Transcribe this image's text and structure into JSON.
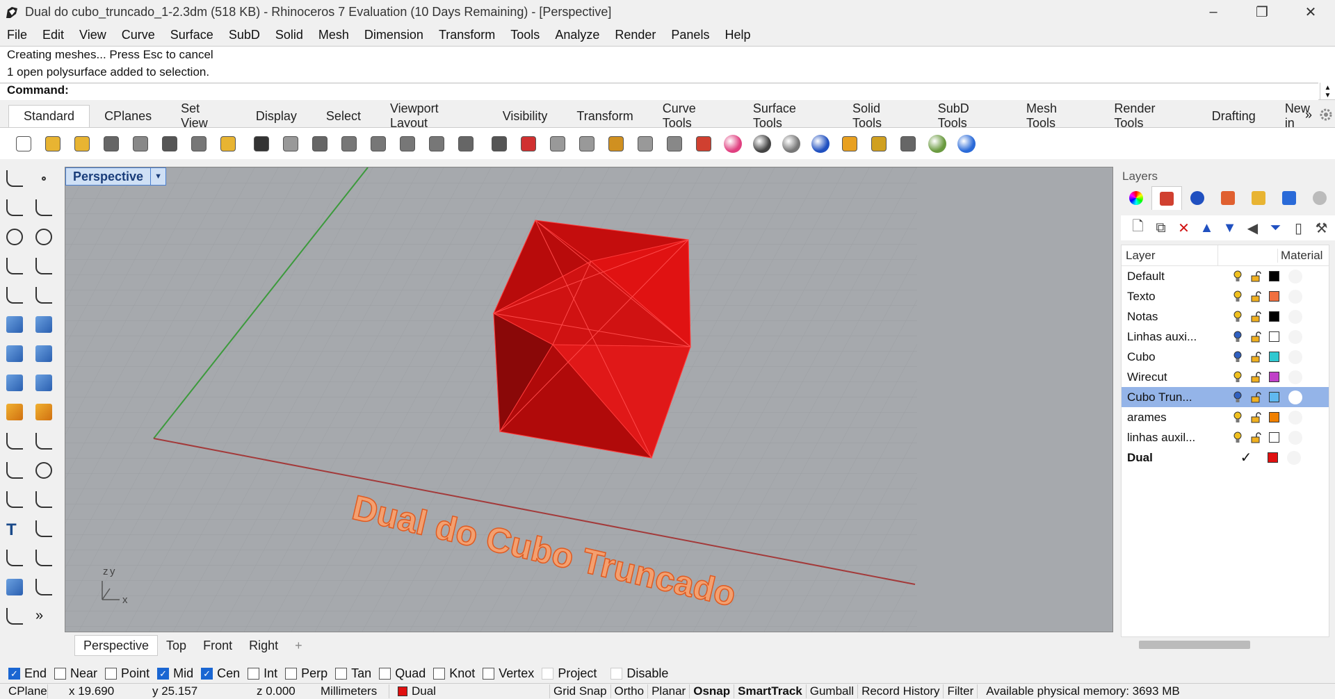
{
  "window": {
    "title": "Dual do cubo_truncado_1-2.3dm (518 KB) - Rhinoceros 7 Evaluation (10 Days Remaining) - [Perspective]",
    "controls": [
      "–",
      "❐",
      "✕"
    ]
  },
  "menu": [
    "File",
    "Edit",
    "View",
    "Curve",
    "Surface",
    "SubD",
    "Solid",
    "Mesh",
    "Dimension",
    "Transform",
    "Tools",
    "Analyze",
    "Render",
    "Panels",
    "Help"
  ],
  "command": {
    "history": [
      "Creating meshes... Press Esc to cancel",
      "1 open polysurface added to selection."
    ],
    "prompt": "Command:"
  },
  "toolbar_tabs": [
    "Standard",
    "CPlanes",
    "Set View",
    "Display",
    "Select",
    "Viewport Layout",
    "Visibility",
    "Transform",
    "Curve Tools",
    "Surface Tools",
    "Solid Tools",
    "SubD Tools",
    "Mesh Tools",
    "Render Tools",
    "Drafting",
    "New in"
  ],
  "toolbar_overflow": "»",
  "toolbar_icons": [
    {
      "name": "new-file-icon",
      "color": "#ffffff"
    },
    {
      "name": "open-file-icon",
      "color": "#e8b432"
    },
    {
      "name": "save-icon",
      "color": "#e8b432"
    },
    {
      "name": "print-icon",
      "color": "#666666"
    },
    {
      "name": "import-icon",
      "color": "#888888"
    },
    {
      "name": "cut-icon",
      "color": "#555555"
    },
    {
      "name": "copy-icon",
      "color": "#777777"
    },
    {
      "name": "paste-icon",
      "color": "#e8b432"
    },
    {
      "name": "undo-icon",
      "color": "#333333"
    },
    {
      "name": "pan-hand-icon",
      "color": "#999999"
    },
    {
      "name": "rotate-view-icon",
      "color": "#666666"
    },
    {
      "name": "zoom-icon",
      "color": "#777777"
    },
    {
      "name": "zoom-window-icon",
      "color": "#777777"
    },
    {
      "name": "zoom-extents-icon",
      "color": "#777777"
    },
    {
      "name": "zoom-selected-icon",
      "color": "#777777"
    },
    {
      "name": "rotate-camera-icon",
      "color": "#666666"
    },
    {
      "name": "four-viewports-icon",
      "color": "#555555"
    },
    {
      "name": "car-icon",
      "color": "#d03030"
    },
    {
      "name": "grid-icon",
      "color": "#999999"
    },
    {
      "name": "snap-icon",
      "color": "#999999"
    },
    {
      "name": "points-icon",
      "color": "#d09020"
    },
    {
      "name": "light-bulb-icon",
      "color": "#999999"
    },
    {
      "name": "lock-icon",
      "color": "#888888"
    },
    {
      "name": "layer-icon",
      "color": "#d04030"
    },
    {
      "name": "color-wheel-icon",
      "color": "#e04080"
    },
    {
      "name": "shaded-sphere-icon",
      "color": "#444444"
    },
    {
      "name": "render-sphere-icon",
      "color": "#777777"
    },
    {
      "name": "blue-sphere-icon",
      "color": "#2050c0"
    },
    {
      "name": "material-funnel-icon",
      "color": "#e8a020"
    },
    {
      "name": "gear-options-icon",
      "color": "#d0a020"
    },
    {
      "name": "dimension-icon",
      "color": "#666666"
    },
    {
      "name": "globe-icon",
      "color": "#6a9a40"
    },
    {
      "name": "help-icon",
      "color": "#2a6ad8"
    }
  ],
  "left_tools": [
    "select-arrow-icon",
    "point-icon",
    "polyline-icon",
    "arc-curve-icon",
    "circle-icon",
    "ellipse-icon",
    "curve-arc-icon",
    "rectangle-icon",
    "polygon-icon",
    "fillet-curve-icon",
    "surface-corner-icon",
    "surface-edit-icon",
    "box-solid-icon",
    "boolean-icon",
    "cylinder-icon",
    "mesh-surface-icon",
    "transform-gear-icon",
    "arrow-orange-icon",
    "split-icon",
    "trim-icon",
    "group-icon",
    "array-circles-icon",
    "rotate-curve-icon",
    "sweep-icon",
    "text-icon",
    "scale-icon",
    "snap-grid-icon",
    "mirror-icon",
    "render-box-icon",
    "array-icon",
    "dots-grid-icon",
    "more-tools-icon"
  ],
  "viewport": {
    "name": "Perspective",
    "dropdown": "▼",
    "axis_labels": {
      "z": "z",
      "y": "y",
      "x": "x"
    },
    "object_text": "Dual do Cubo Truncado",
    "object_color": "#e01010",
    "text_color": "#f0703a"
  },
  "viewport_tabs": [
    "Perspective",
    "Top",
    "Front",
    "Right"
  ],
  "viewport_tab_add": "+",
  "panel": {
    "title": "Layers",
    "tabs": [
      "color-wheel-icon",
      "layers-tab-icon",
      "render-sphere-icon",
      "brush-icon",
      "folder-icon",
      "help-icon",
      "settings-gear-icon"
    ],
    "tools": [
      "new-layer-icon",
      "new-sublayer-icon",
      "delete-layer-icon",
      "move-up-icon",
      "move-down-icon",
      "move-left-icon",
      "filter-icon",
      "copy-layer-icon",
      "tools-icon"
    ],
    "columns": {
      "layer": "Layer",
      "material": "Material"
    },
    "layers": [
      {
        "name": "Default",
        "bulb": "#f0c020",
        "color": "#000000",
        "current": false,
        "selected": false
      },
      {
        "name": "Texto",
        "bulb": "#f0c020",
        "color": "#f07040",
        "current": false,
        "selected": false
      },
      {
        "name": "Notas",
        "bulb": "#f0c020",
        "color": "#000000",
        "current": false,
        "selected": false
      },
      {
        "name": "Linhas auxi...",
        "bulb": "#3060c0",
        "color": "#ffffff",
        "current": false,
        "selected": false
      },
      {
        "name": "Cubo",
        "bulb": "#3060c0",
        "color": "#30c8d0",
        "current": false,
        "selected": false
      },
      {
        "name": "Wirecut",
        "bulb": "#f0c020",
        "color": "#c040c8",
        "current": false,
        "selected": false
      },
      {
        "name": "Cubo Trun...",
        "bulb": "#3060c0",
        "color": "#60b8f0",
        "current": false,
        "selected": true
      },
      {
        "name": "arames",
        "bulb": "#f0c020",
        "color": "#f08000",
        "current": false,
        "selected": false
      },
      {
        "name": "linhas auxil...",
        "bulb": "#f0c020",
        "color": "#ffffff",
        "current": false,
        "selected": false
      },
      {
        "name": "Dual",
        "bulb": "",
        "color": "#e01010",
        "current": true,
        "selected": false
      }
    ],
    "current_mark": "✓"
  },
  "osnap": [
    {
      "label": "End",
      "checked": true
    },
    {
      "label": "Near",
      "checked": false
    },
    {
      "label": "Point",
      "checked": false
    },
    {
      "label": "Mid",
      "checked": true
    },
    {
      "label": "Cen",
      "checked": true
    },
    {
      "label": "Int",
      "checked": false
    },
    {
      "label": "Perp",
      "checked": false
    },
    {
      "label": "Tan",
      "checked": false
    },
    {
      "label": "Quad",
      "checked": false
    },
    {
      "label": "Knot",
      "checked": false
    },
    {
      "label": "Vertex",
      "checked": false
    },
    {
      "label": "Project",
      "checked": false
    },
    {
      "label": "Disable",
      "checked": false
    }
  ],
  "status": {
    "cplane": "CPlane",
    "x": "x 19.690",
    "y": "y 25.157",
    "z": "z 0.000",
    "units": "Millimeters",
    "layer": "Dual",
    "layer_color": "#e01010",
    "toggles": [
      "Grid Snap",
      "Ortho",
      "Planar",
      "Osnap",
      "SmartTrack",
      "Gumball",
      "Record History",
      "Filter"
    ],
    "toggles_bold": [
      "Osnap",
      "SmartTrack"
    ],
    "memory": "Available physical memory: 3693 MB"
  }
}
